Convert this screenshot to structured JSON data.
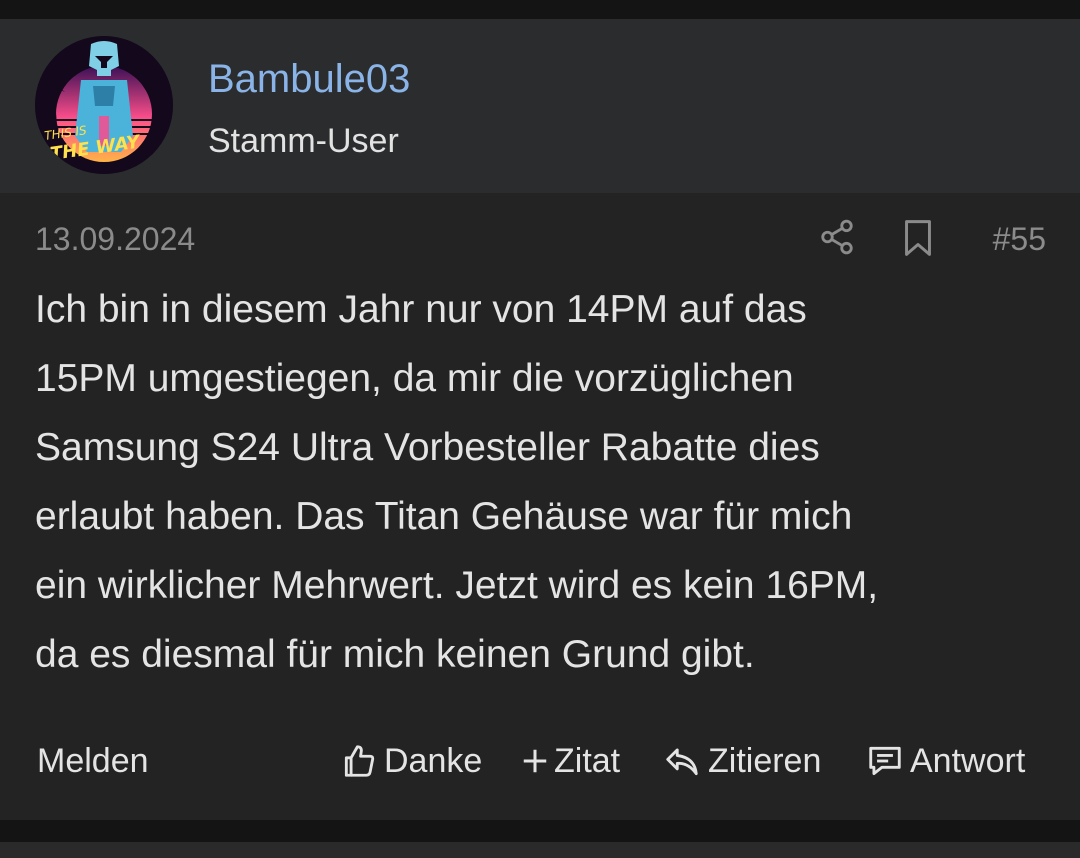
{
  "author": {
    "avatar_icon": "avatar-synthwave-mandalorian",
    "avatar_text": "THIS IS THE WAY",
    "username": "Bambule03",
    "title": "Stamm-User"
  },
  "post": {
    "date": "13.09.2024",
    "number": "#55",
    "share_icon": "share-icon",
    "bookmark_icon": "bookmark-icon",
    "body_lines": [
      "Ich bin in diesem Jahr nur von 14PM auf das",
      "15PM umgestiegen, da mir die vorzüglichen",
      "Samsung S24 Ultra Vorbesteller Rabatte dies",
      "erlaubt haben. Das Titan Gehäuse war für mich",
      "ein wirklicher Mehrwert. Jetzt wird es kein 16PM,",
      "da es diesmal für mich keinen Grund gibt."
    ]
  },
  "actions": {
    "report": "Melden",
    "like": "Danke",
    "quote_add": "Zitat",
    "quote": "Zitieren",
    "reply": "Antwort"
  },
  "colors": {
    "username": "#8ab4e8",
    "post_bg": "#232323",
    "author_bar_bg": "#2b2c2e",
    "muted_text": "#8b8b8b"
  }
}
